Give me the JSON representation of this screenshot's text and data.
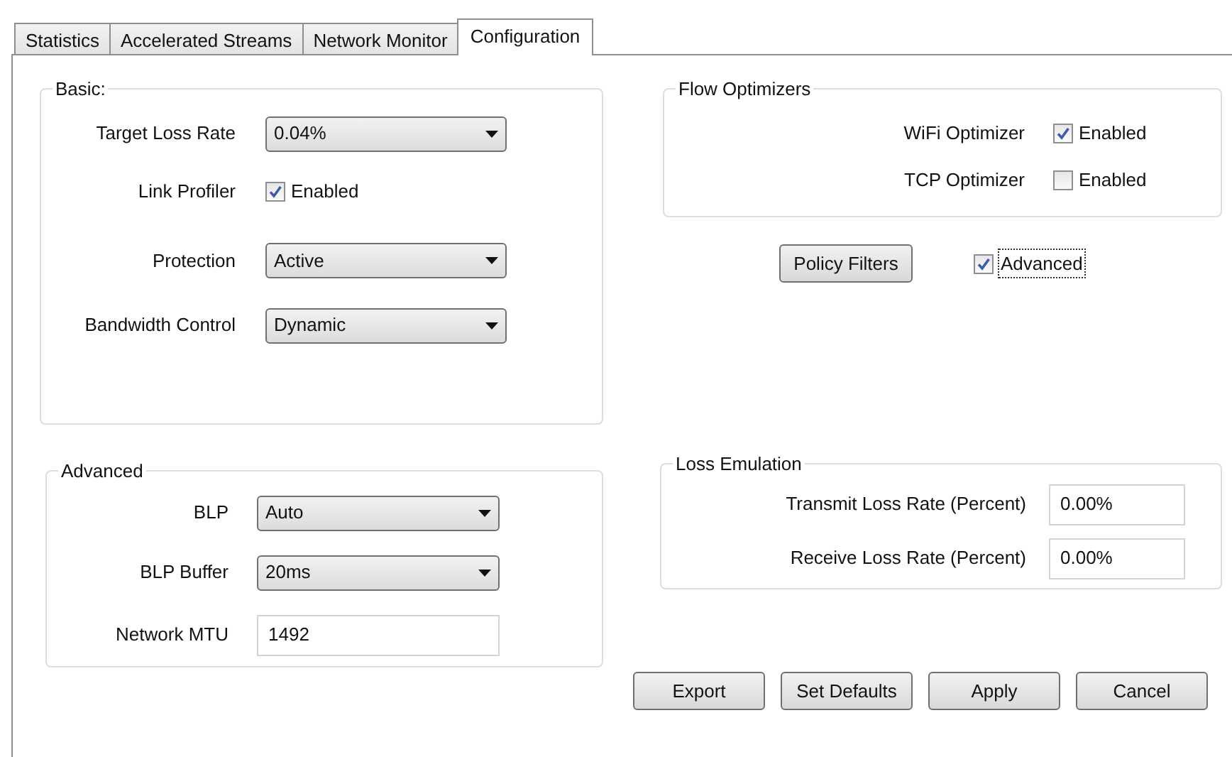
{
  "tabs": [
    {
      "label": "Statistics",
      "selected": false
    },
    {
      "label": "Accelerated Streams",
      "selected": false
    },
    {
      "label": "Network Monitor",
      "selected": false
    },
    {
      "label": "Configuration",
      "selected": true
    }
  ],
  "basic": {
    "title": "Basic:",
    "rows": [
      {
        "kind": "select",
        "label": "Target Loss Rate",
        "value": "0.04%"
      },
      {
        "kind": "checkbox",
        "label": "Link Profiler",
        "text": "Enabled",
        "checked": true
      },
      {
        "kind": "select",
        "label": "Protection",
        "value": "Active"
      },
      {
        "kind": "select",
        "label": "Bandwidth Control",
        "value": "Dynamic"
      }
    ]
  },
  "flow_optimizers": {
    "title": "Flow Optimizers",
    "rows": [
      {
        "kind": "checkbox",
        "label": "WiFi Optimizer",
        "text": "Enabled",
        "checked": true
      },
      {
        "kind": "checkbox",
        "label": "TCP Optimizer",
        "text": "Enabled",
        "checked": false
      }
    ]
  },
  "policy_filters_button": "Policy Filters",
  "advanced_toggle": {
    "text": "Advanced",
    "checked": true,
    "focused": true
  },
  "advanced": {
    "title": "Advanced",
    "rows": [
      {
        "kind": "select",
        "label": "BLP",
        "value": "Auto"
      },
      {
        "kind": "select",
        "label": "BLP Buffer",
        "value": "20ms"
      },
      {
        "kind": "input",
        "label": "Network MTU",
        "value": "1492"
      }
    ]
  },
  "loss_emulation": {
    "title": "Loss Emulation",
    "rows": [
      {
        "kind": "input",
        "label": "Transmit Loss Rate (Percent)",
        "value": "0.00%"
      },
      {
        "kind": "input",
        "label": "Receive Loss Rate (Percent)",
        "value": "0.00%"
      }
    ]
  },
  "buttons": [
    "Export",
    "Set Defaults",
    "Apply",
    "Cancel"
  ]
}
